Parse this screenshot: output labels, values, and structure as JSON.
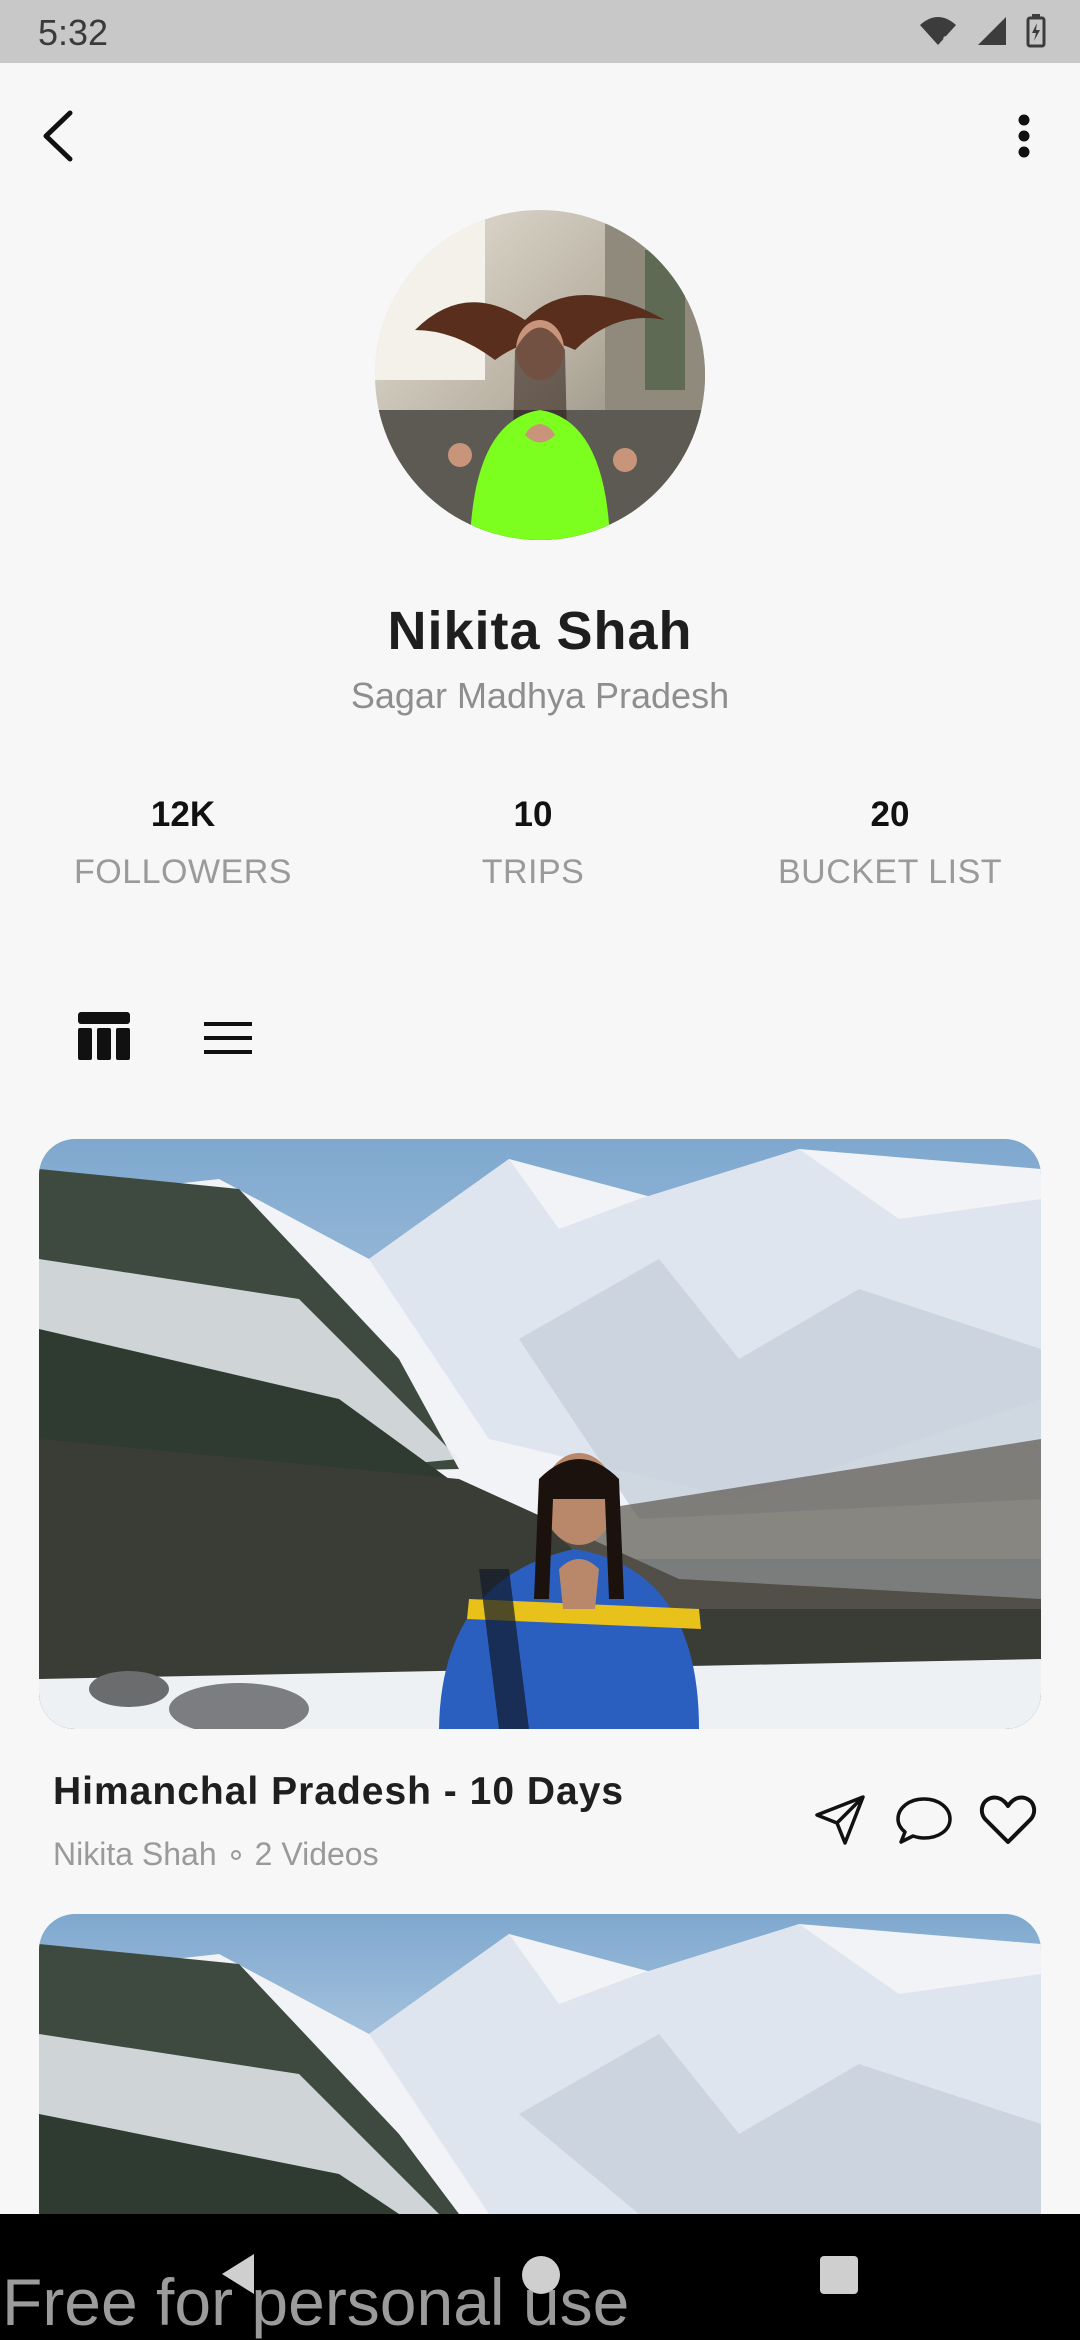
{
  "status_bar": {
    "time": "5:32",
    "icons": [
      "wifi-icon",
      "signal-icon",
      "battery-icon"
    ]
  },
  "header": {
    "back_icon": "chevron-left-icon",
    "menu_icon": "more-vertical-icon"
  },
  "profile": {
    "name": "Nikita Shah",
    "location": "Sagar Madhya Pradesh",
    "avatar_accent": "#7cff1e"
  },
  "stats": [
    {
      "value": "12K",
      "label": "FOLLOWERS"
    },
    {
      "value": "10",
      "label": "TRIPS"
    },
    {
      "value": "20",
      "label": "BUCKET LIST"
    }
  ],
  "view_toggle": {
    "options": [
      "grid-icon",
      "list-icon"
    ],
    "selected": "grid-icon"
  },
  "trips": [
    {
      "title": "Himanchal Pradesh - 10 Days",
      "author": "Nikita Shah",
      "videos": "2 Videos",
      "actions": [
        "send-icon",
        "comment-icon",
        "heart-icon"
      ]
    },
    {
      "title": "",
      "author": "",
      "videos": ""
    }
  ],
  "nav_bar": {
    "buttons": [
      "nav-back-icon",
      "nav-home-icon",
      "nav-recents-icon"
    ]
  },
  "watermark": "Free for personal use",
  "colors": {
    "background": "#f7f7f8",
    "text_primary": "#1e1e1e",
    "text_secondary": "#9a9a9a",
    "status_bar": "#c8c8c8",
    "nav_bar": "#000000"
  }
}
